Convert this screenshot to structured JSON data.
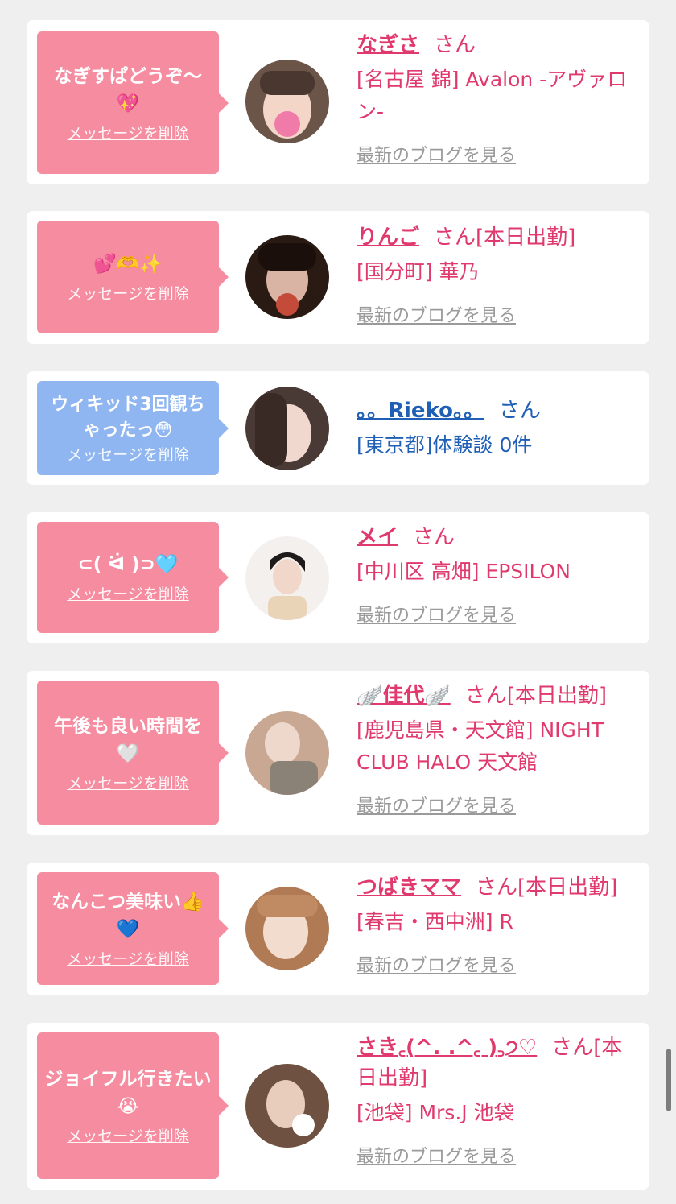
{
  "cards": [
    {
      "bubble_text": "なぎすぱどうぞ〜💖",
      "bubble_color": "pink",
      "delete_label": "メッセージを削除",
      "name": "なぎさ",
      "san": "さん",
      "shop": "[名古屋 錦] Avalon -アヴァロン-",
      "blog_label": "最新のブログを見る",
      "avatar_colors": [
        "#6b5549",
        "#f3d6c8"
      ]
    },
    {
      "bubble_text": "💕🫶✨",
      "bubble_color": "pink",
      "delete_label": "メッセージを削除",
      "name": "りんご",
      "san": "さん[本日出勤]",
      "shop": "[国分町] 華乃",
      "blog_label": "最新のブログを見る",
      "avatar_colors": [
        "#2a1a14",
        "#c44b3a"
      ]
    },
    {
      "bubble_text": "ウィキッド3回観ちゃったっ😳",
      "bubble_color": "blue",
      "delete_label": "メッセージを削除",
      "name": "。。Rieko。。",
      "san": "さん",
      "shop": "[東京都]体験談 0件",
      "blog_label": "",
      "avatar_colors": [
        "#4a3a36",
        "#f0d8cf"
      ]
    },
    {
      "bubble_text": "⊂( ᐛ )⊃🩵",
      "bubble_color": "pink",
      "delete_label": "メッセージを削除",
      "name": "メイ",
      "san": "さん",
      "shop": "[中川区 高畑] EPSILON",
      "blog_label": "最新のブログを見る",
      "avatar_colors": [
        "#f4f0ee",
        "#1e1a1a"
      ]
    },
    {
      "bubble_text": "午後も良い時間を🤍",
      "bubble_color": "pink",
      "delete_label": "メッセージを削除",
      "name": "🪽佳代🪽",
      "san": "さん[本日出勤]",
      "shop": "[鹿児島県・天文館] NIGHT CLUB HALO 天文館",
      "blog_label": "最新のブログを見る",
      "avatar_colors": [
        "#c9a893",
        "#eed8cc"
      ]
    },
    {
      "bubble_text": "なんこつ美味い👍💙",
      "bubble_color": "pink",
      "delete_label": "メッセージを削除",
      "name": "つばきママ",
      "san": "さん[本日出勤]",
      "shop": "[春吉・西中洲] R",
      "blog_label": "最新のブログを見る",
      "avatar_colors": [
        "#b07a55",
        "#f2dccd"
      ]
    },
    {
      "bubble_text": "ジョイフル行きたい😭",
      "bubble_color": "pink",
      "delete_label": "メッセージを削除",
      "name": "さき꜀(^. .^꜀ )꜆੭♡",
      "san": "さん[本日出勤]",
      "shop": "[池袋] Mrs.J 池袋",
      "blog_label": "最新のブログを見る",
      "avatar_colors": [
        "#6e5140",
        "#e8cdbd"
      ]
    }
  ]
}
